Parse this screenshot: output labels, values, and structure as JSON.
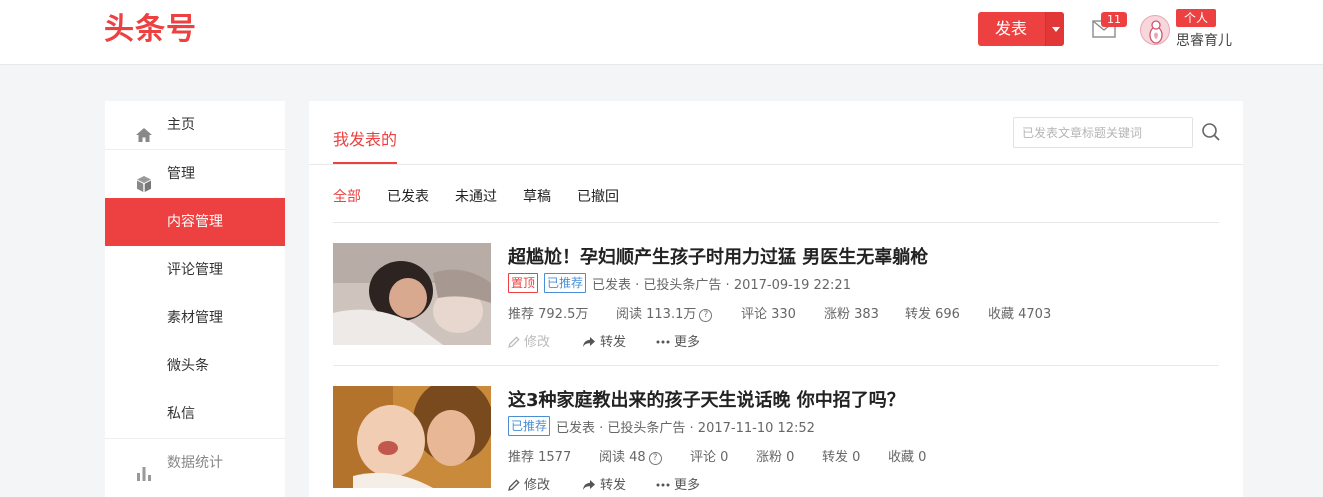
{
  "header": {
    "logo": "头条号",
    "publish_label": "发表",
    "mail_count": "11",
    "account_type": "个人",
    "account_name": "思睿育儿"
  },
  "sidebar": {
    "items": [
      {
        "label": "主页",
        "icon": "home-icon"
      },
      {
        "label": "管理",
        "icon": "cube-icon"
      },
      {
        "label": "内容管理",
        "active": true
      },
      {
        "label": "评论管理"
      },
      {
        "label": "素材管理"
      },
      {
        "label": "微头条"
      },
      {
        "label": "私信"
      },
      {
        "label": "数据统计",
        "icon": "bar-chart-icon"
      }
    ]
  },
  "main": {
    "tab": "我发表的",
    "search_placeholder": "已发表文章标题关键词",
    "filters": [
      "全部",
      "已发表",
      "未通过",
      "草稿",
      "已撤回"
    ],
    "articles": [
      {
        "title": "超尴尬！孕妇顺产生孩子时用力过猛 男医生无辜躺枪",
        "tags": [
          "置顶",
          "已推荐"
        ],
        "meta": "已发表 · 已投头条广告 · 2017-09-19 22:21",
        "recommend": "推荐 792.5万",
        "reads": "阅读 113.1万",
        "comments": "评论 330",
        "fans": "涨粉 383",
        "shares": "转发 696",
        "favorites": "收藏 4703",
        "edit": "修改",
        "forward": "转发",
        "more": "更多"
      },
      {
        "title": "这3种家庭教出来的孩子天生说话晚 你中招了吗？",
        "tags": [
          "已推荐"
        ],
        "meta": "已发表 · 已投头条广告 · 2017-11-10 12:52",
        "recommend": "推荐 1577",
        "reads": "阅读 48",
        "comments": "评论 0",
        "fans": "涨粉 0",
        "shares": "转发 0",
        "favorites": "收藏 0",
        "edit": "修改",
        "forward": "转发",
        "more": "更多"
      }
    ]
  }
}
